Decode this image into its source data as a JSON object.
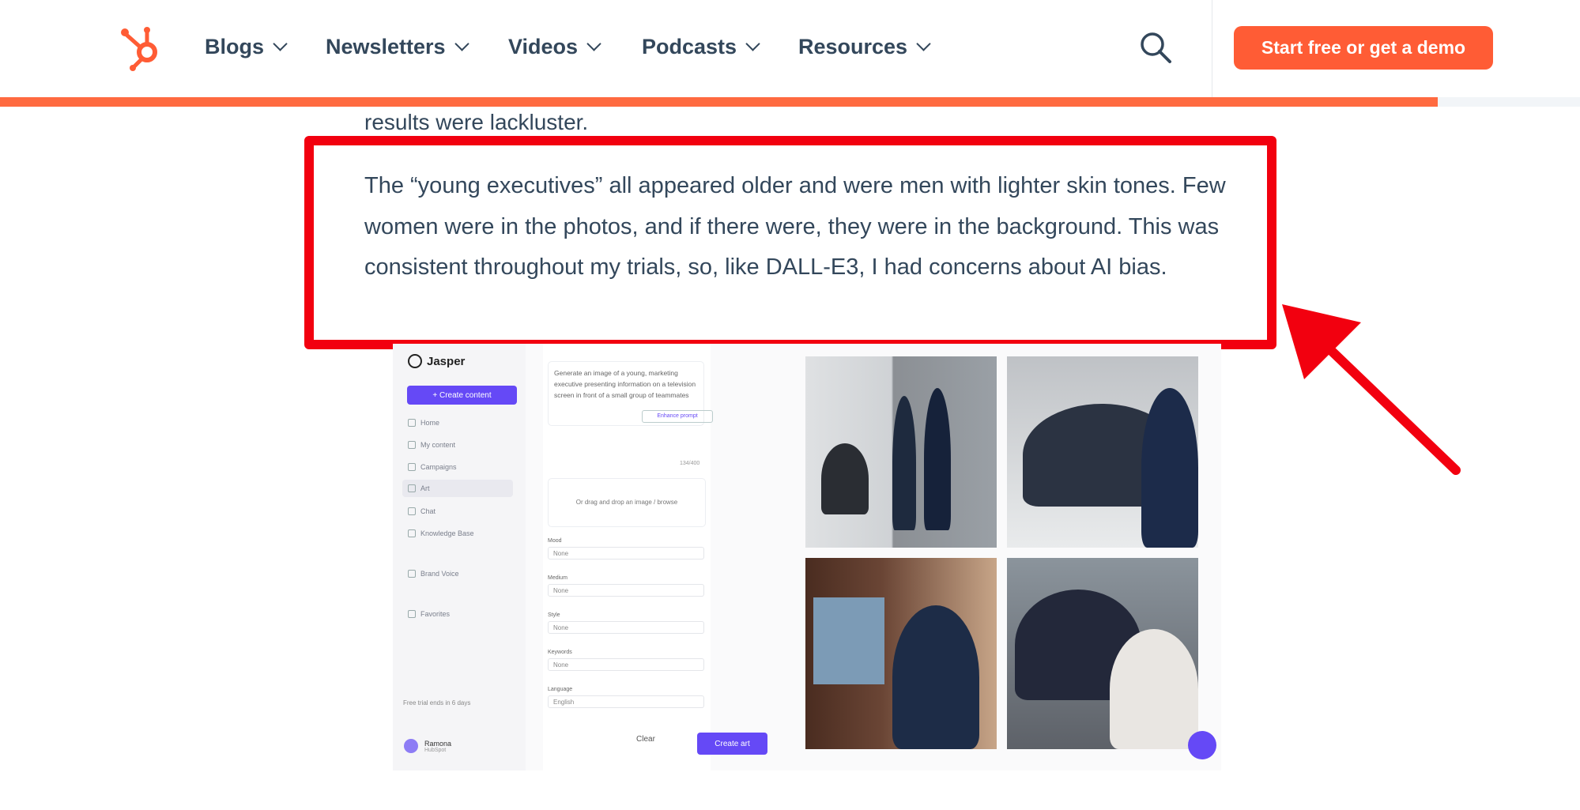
{
  "nav": {
    "items": [
      {
        "label": "Blogs"
      },
      {
        "label": "Newsletters"
      },
      {
        "label": "Videos"
      },
      {
        "label": "Podcasts"
      },
      {
        "label": "Resources"
      }
    ],
    "cta_label": "Start free or get a demo",
    "icons": {
      "logo": "hubspot-sprocket-icon",
      "search": "search-icon",
      "chevron": "chevron-down-icon"
    }
  },
  "reading_progress": {
    "percent": 91
  },
  "article": {
    "prev_line": "results were lackluster.",
    "highlighted_paragraph": "The “young executives” all appeared older and were men with lighter skin tones. Few women were in the photos, and if there were, they were in the background. This was consistent throughout my trials, so, like DALL-E3, I had concerns about AI bias."
  },
  "colors": {
    "accent": "#ff5c35",
    "highlight": "#f2000f",
    "text": "#33475b",
    "jasper": "#6549f6"
  },
  "embedded_screenshot": {
    "brand": "Jasper",
    "create_button": "+ Create content",
    "sidebar": [
      {
        "label": "Home"
      },
      {
        "label": "My content"
      },
      {
        "label": "Campaigns"
      },
      {
        "label": "Art"
      },
      {
        "label": "Chat"
      },
      {
        "label": "Knowledge Base"
      },
      {
        "label": "Brand Voice"
      },
      {
        "label": "Favorites"
      }
    ],
    "trial": "Free trial ends in 6 days",
    "user": {
      "name": "Ramona",
      "org": "HubSpot"
    },
    "prompt": "Generate an image of a young, marketing executive presenting information on a television screen in front of a small group of teammates",
    "enhance": "Enhance prompt",
    "char_count": "134/400",
    "drop_text": "Or drag and drop an image / browse",
    "fields": [
      {
        "label": "Mood",
        "value": "None"
      },
      {
        "label": "Medium",
        "value": "None"
      },
      {
        "label": "Style",
        "value": "None"
      },
      {
        "label": "Keywords",
        "value": "None"
      },
      {
        "label": "Language",
        "value": "English"
      }
    ],
    "clear": "Clear",
    "create_art": "Create art"
  }
}
